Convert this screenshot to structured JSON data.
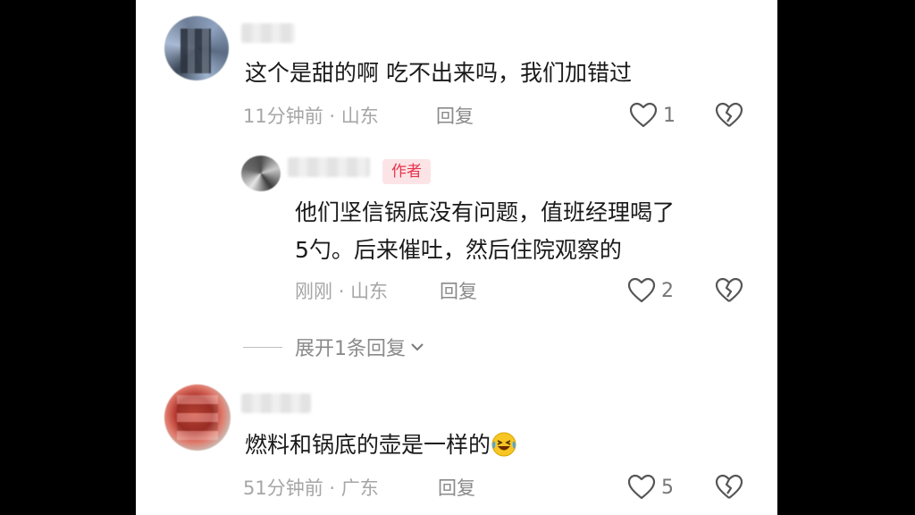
{
  "comments": [
    {
      "text": "这个是甜的啊 吃不出来吗，我们加错过",
      "time": "11分钟前",
      "location": "山东",
      "reply_label": "回复",
      "likes": "1"
    },
    {
      "author_tag": "作者",
      "text_line1": "他们坚信锅底没有问题，值班经理喝了",
      "text_line2": "5勺。后来催吐，然后住院观察的",
      "time": "刚刚",
      "location": "山东",
      "reply_label": "回复",
      "likes": "2"
    },
    {
      "text": "燃料和锅底的壶是一样的",
      "emoji": "laughing-crying-emoji",
      "time": "51分钟前",
      "location": "广东",
      "reply_label": "回复",
      "likes": "5"
    }
  ],
  "expand_replies_label": "展开1条回复",
  "dot": "·",
  "icons": [
    "heart-icon",
    "broken-heart-icon",
    "chevron-down-icon"
  ],
  "colors": {
    "author_tag_bg": "#fce4e6",
    "author_tag_text": "#e8344e"
  }
}
